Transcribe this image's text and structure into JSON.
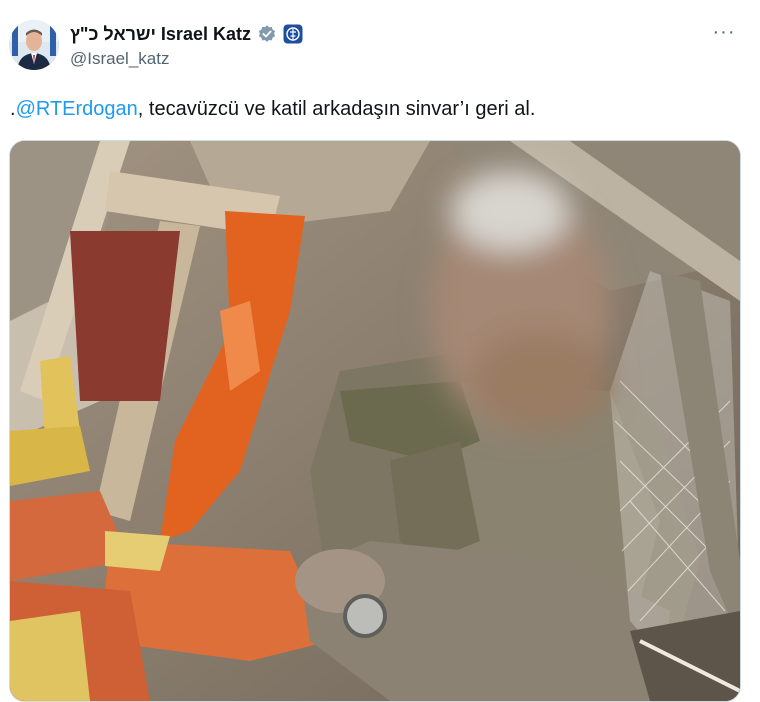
{
  "tweet": {
    "display_name": "ישראל כ\"ץ Israel Katz",
    "handle": "@Israel_katz",
    "more_label": "···",
    "text": {
      "prefix": ".",
      "mention": "@RTErdogan",
      "rest": ", tecavüzcü ve katil arkadaşın sinvar’ı geri al."
    },
    "media": {
      "blurred_region": "face"
    }
  },
  "icons": {
    "avatar": "profile-photo",
    "verified": "verified-badge-icon",
    "affiliation": "government-emblem-icon",
    "more": "more-options-icon"
  },
  "colors": {
    "link": "#1d9bf0",
    "verified_badge": "#829aab",
    "secondary_text": "#536471"
  }
}
